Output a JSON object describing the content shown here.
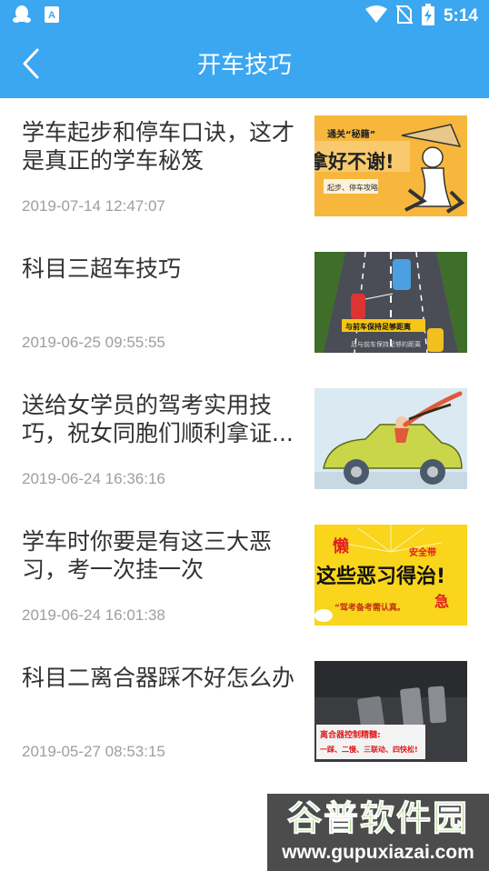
{
  "status_bar": {
    "time": "5:14",
    "icons": [
      "qq-icon",
      "store-icon",
      "wifi-icon",
      "no-sim-icon",
      "battery-charging-icon"
    ]
  },
  "header": {
    "title": "开车技巧",
    "back_icon": "chevron-left-icon"
  },
  "articles": [
    {
      "title": "学车起步和停车口诀，这才是真正的学车秘笈",
      "date": "2019-07-14 12:47:07",
      "thumb": {
        "line1": "通关“秘籍”",
        "line2": "拿好不谢!",
        "line3": "起步、停车攻略"
      }
    },
    {
      "title": "科目三超车技巧",
      "date": "2019-06-25 09:55:55",
      "thumb": {
        "line1": "与前车保持足够距离",
        "line2": "后与前车保持足够的距离"
      }
    },
    {
      "title": "送给女学员的驾考实用技巧，祝女同胞们顺利拿证...",
      "date": "2019-06-24 16:36:16"
    },
    {
      "title": "学车时你要是有这三大恶习，考一次挂一次",
      "date": "2019-06-24 16:01:38",
      "thumb": {
        "tag1": "懒",
        "tag2": "安全带",
        "headline": "这些恶习得治!",
        "tag3": "急",
        "footer": "“驾考备考需认真。"
      }
    },
    {
      "title": "科目二离合器踩不好怎么办",
      "date": "2019-05-27 08:53:15",
      "thumb": {
        "line1": "离合器控制精髓:",
        "line2": "一踩、二慢、三联动、四快松!"
      }
    }
  ],
  "watermark": {
    "brand": "谷普软件园",
    "url": "www.gupuxiazai.com"
  },
  "colors": {
    "primary": "#3aa7f0",
    "title_text": "#333333",
    "date_text": "#9e9e9e"
  }
}
